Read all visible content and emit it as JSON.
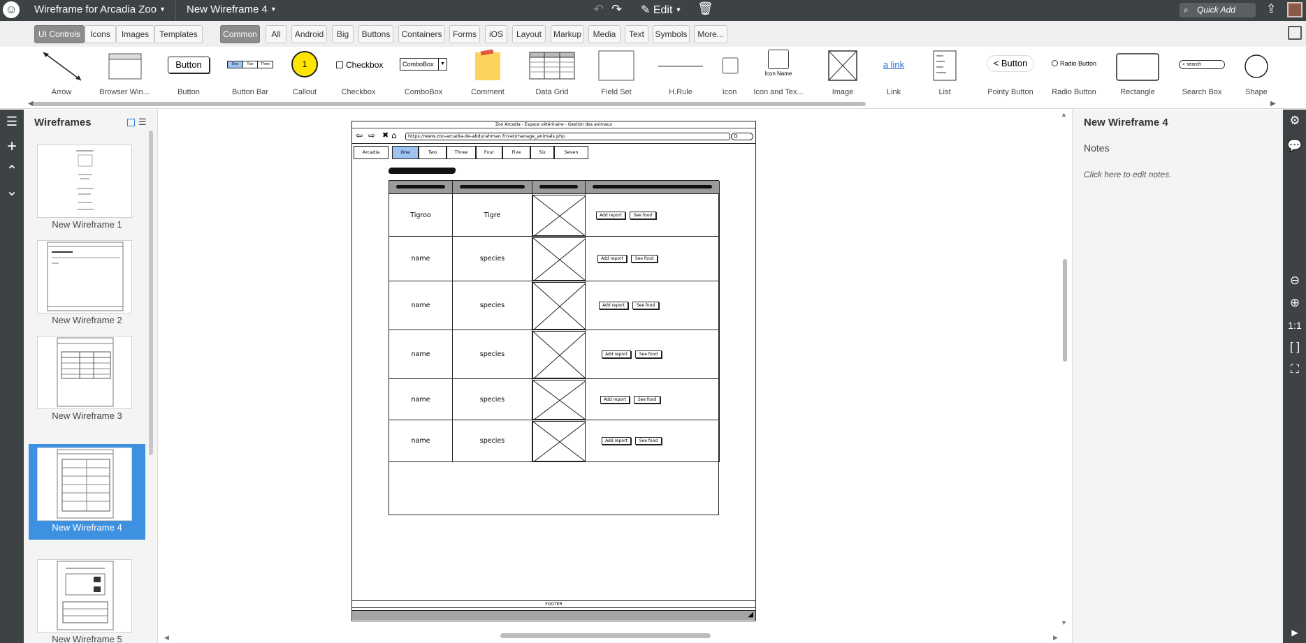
{
  "topbar": {
    "project": "Wireframe for Arcadia Zoo",
    "wireframe": "New Wireframe 4",
    "edit": "Edit",
    "quick_add": "Quick Add"
  },
  "library": {
    "tabs": [
      "UI Controls",
      "Icons",
      "Images",
      "Templates"
    ],
    "active_tab": "UI Controls",
    "filters": [
      "Common",
      "All",
      "Android",
      "Big",
      "Buttons",
      "Containers",
      "Forms",
      "iOS",
      "Layout",
      "Markup",
      "Media",
      "Text",
      "Symbols",
      "More..."
    ],
    "active_filter": "Common",
    "components": [
      {
        "label": "Arrow"
      },
      {
        "label": "Browser Win..."
      },
      {
        "label": "Button",
        "preview": "Button"
      },
      {
        "label": "Button Bar",
        "preview": [
          "One",
          "Two",
          "Three"
        ]
      },
      {
        "label": "Callout",
        "preview": "1"
      },
      {
        "label": "Checkbox",
        "preview": "Checkbox"
      },
      {
        "label": "ComboBox",
        "preview": "ComboBox"
      },
      {
        "label": "Comment"
      },
      {
        "label": "Data Grid"
      },
      {
        "label": "Field Set"
      },
      {
        "label": "H.Rule"
      },
      {
        "label": "Icon"
      },
      {
        "label": "Icon and Tex...",
        "preview": "Icon Name"
      },
      {
        "label": "Image"
      },
      {
        "label": "Link",
        "preview": "a link"
      },
      {
        "label": "List"
      },
      {
        "label": "Pointy Button",
        "preview": "Button"
      },
      {
        "label": "Radio Button",
        "preview": "Radio Button"
      },
      {
        "label": "Rectangle"
      },
      {
        "label": "Search Box",
        "preview": "search"
      },
      {
        "label": "Shape"
      }
    ]
  },
  "wireframes_panel": {
    "title": "Wireframes",
    "items": [
      {
        "label": "New Wireframe 1"
      },
      {
        "label": "New Wireframe 2"
      },
      {
        "label": "New Wireframe 3"
      },
      {
        "label": "New Wireframe 4",
        "selected": true
      },
      {
        "label": "New Wireframe 5"
      }
    ]
  },
  "mockup": {
    "window_title": "Zoo Arcadia - Espace vétérinaire - Gestion des animaux",
    "url": "https://www.zoo-arcadia-de-abdurahman.fr/vet/manage_animals.php",
    "search_placeholder": "Q",
    "brand_tab": "Arcadia",
    "tabs": [
      "One",
      "Two",
      "Three",
      "Four",
      "Five",
      "Six",
      "Seven"
    ],
    "selected_tab": "One",
    "rows": [
      {
        "name": "Tigroo",
        "species": "Tigre"
      },
      {
        "name": "name",
        "species": "species"
      },
      {
        "name": "name",
        "species": "species"
      },
      {
        "name": "name",
        "species": "species"
      },
      {
        "name": "name",
        "species": "species"
      },
      {
        "name": "name",
        "species": "species"
      }
    ],
    "add_report": "Add report",
    "see_food": "See food",
    "footer": "FOOTER"
  },
  "properties": {
    "title": "New Wireframe 4",
    "notes_label": "Notes",
    "notes_hint": "Click here to edit notes."
  },
  "zoom": {
    "actual_size": "1:1"
  },
  "colors": {
    "chrome": "#3d4245",
    "selection": "#3e91e0",
    "tab_selected": "#9fc3f0"
  }
}
